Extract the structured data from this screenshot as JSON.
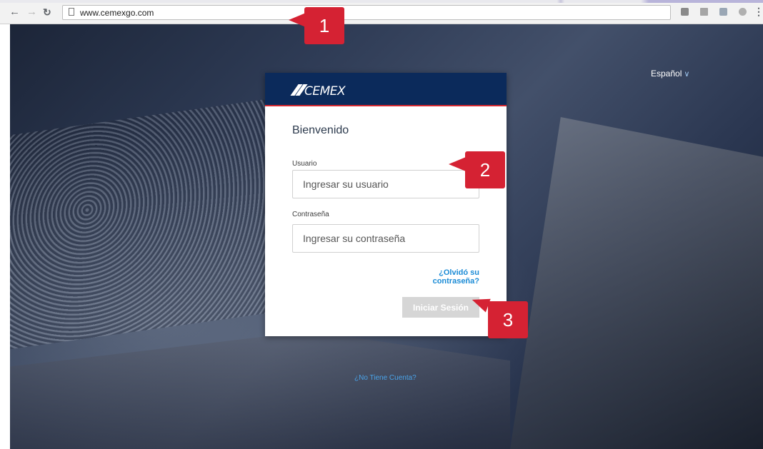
{
  "browser": {
    "back_icon": "arrow-left-icon",
    "forward_icon": "arrow-right-icon",
    "reload_icon": "reload-icon",
    "url": "www.cemexgo.com"
  },
  "header": {
    "language": "Español"
  },
  "login": {
    "brand": "CEMEX",
    "welcome": "Bienvenido",
    "username_label": "Usuario",
    "username_placeholder": "Ingresar su usuario",
    "password_label": "Contraseña",
    "password_placeholder": "Ingresar su contraseña",
    "forgot_password": "¿Olvidó su contraseña?",
    "submit": "Iniciar Sesión"
  },
  "footer": {
    "no_account": "¿No Tiene Cuenta?"
  },
  "markers": [
    "1",
    "2",
    "3"
  ],
  "colors": {
    "brand_blue": "#0b2a5b",
    "brand_red": "#d7282f",
    "marker_red": "#d52233",
    "link_blue": "#1a8bd6",
    "button_disabled": "#d6d6d6"
  }
}
